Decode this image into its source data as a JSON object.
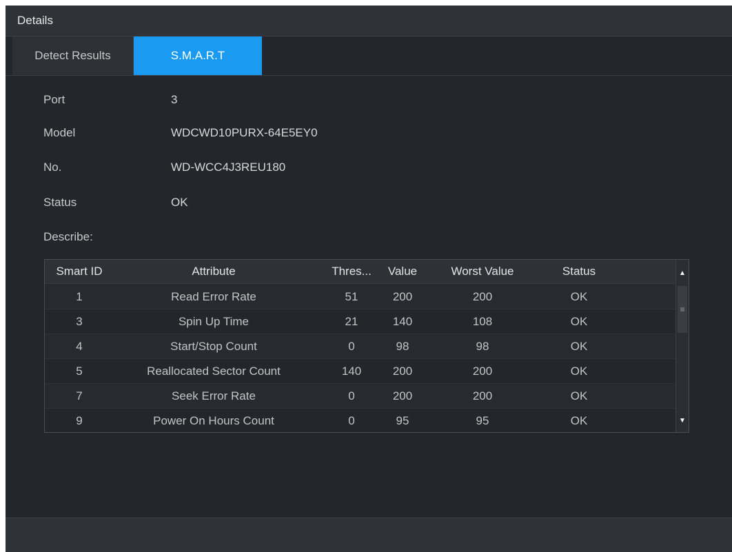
{
  "window": {
    "title": "Details"
  },
  "tabs": [
    {
      "label": "Detect Results",
      "active": false
    },
    {
      "label": "S.M.A.R.T",
      "active": true
    }
  ],
  "info": {
    "port": {
      "label": "Port",
      "value": "3"
    },
    "model": {
      "label": "Model",
      "value": "WDCWD10PURX-64E5EY0"
    },
    "no": {
      "label": "No.",
      "value": "WD-WCC4J3REU180"
    },
    "status": {
      "label": "Status",
      "value": "OK"
    },
    "describe": {
      "label": "Describe:"
    }
  },
  "table": {
    "headers": [
      "Smart ID",
      "Attribute",
      "Thres...",
      "Value",
      "Worst Value",
      "Status"
    ],
    "rows": [
      [
        "1",
        "Read Error Rate",
        "51",
        "200",
        "200",
        "OK"
      ],
      [
        "3",
        "Spin Up Time",
        "21",
        "140",
        "108",
        "OK"
      ],
      [
        "4",
        "Start/Stop Count",
        "0",
        "98",
        "98",
        "OK"
      ],
      [
        "5",
        "Reallocated Sector Count",
        "140",
        "200",
        "200",
        "OK"
      ],
      [
        "7",
        "Seek Error Rate",
        "0",
        "200",
        "200",
        "OK"
      ],
      [
        "9",
        "Power On Hours Count",
        "0",
        "95",
        "95",
        "OK"
      ]
    ]
  },
  "colors": {
    "accent": "#1a9af0",
    "background": "#23262b"
  },
  "icons": {
    "scroll_up": "triangle-up-icon",
    "scroll_down": "triangle-down-icon",
    "thumb_grip": "menu-lines-icon"
  }
}
